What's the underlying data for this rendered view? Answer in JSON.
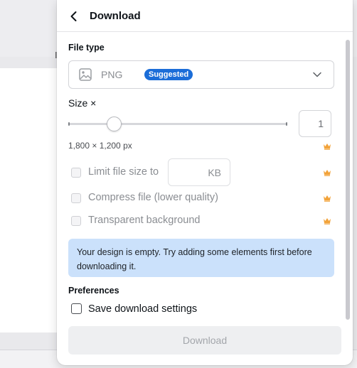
{
  "header": {
    "title": "Download"
  },
  "background": {
    "partial_label": "I"
  },
  "file_type": {
    "label": "File type",
    "value": "PNG",
    "badge": "Suggested",
    "badge_color": "#1b6dd8"
  },
  "size": {
    "label": "Size ×",
    "value": "1",
    "slider_fraction": 0.2,
    "dimensions": "1,800 × 1,200 px"
  },
  "options": {
    "limit_size_label": "Limit file size to",
    "limit_size_unit": "KB",
    "compress_label": "Compress file (lower quality)",
    "transparent_label": "Transparent background",
    "premium_icon": "crown-icon",
    "premium_color": "#f2a33a"
  },
  "notice": {
    "text": "Your design is empty. Try adding some elements first before downloading it.",
    "color": "#cbe1fb"
  },
  "preferences": {
    "label": "Preferences",
    "save_settings_label": "Save download settings"
  },
  "action": {
    "download_label": "Download"
  }
}
